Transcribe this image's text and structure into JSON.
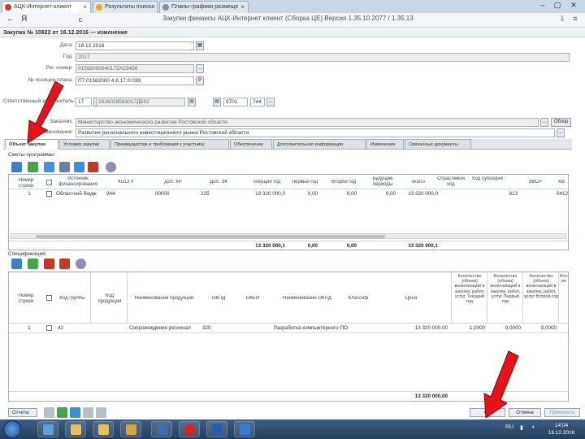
{
  "browser": {
    "tabs": [
      {
        "label": "АЦК-Интернет-клиент",
        "active": true
      },
      {
        "label": "Результаты поиска",
        "active": false
      },
      {
        "label": "Планы-графики размеще",
        "active": false
      }
    ],
    "back": "←",
    "yandex": "Я",
    "reload": "c",
    "url": "Закупки финансы АЦК-Интернет клиент (Сборка ЦЕ) Версия 1.35.10.2077 / 1.35.13"
  },
  "app": {
    "document_title": "Закупка № 10822 от 16.12.2016 — изменение",
    "fields": {
      "date_label": "Дата:",
      "date_value": "18.12.2016",
      "year_label": "Год:",
      "year_value": "2017",
      "reg_number_label": "Рег. номер:",
      "reg_number_value": "0159200004017ZA23456",
      "plan_number_label": "№ позиции плана:",
      "plan_number_value": "П7.01582000 4.8.17.0.039",
      "customer_label": "Ответственный исполнитель:",
      "customer_code": "17",
      "customer_inn": "2016028583017ДБ02",
      "customer_code2": "9701",
      "customer_code3": "744",
      "organization_label": "Заказчик:",
      "organization_value": "Министерство экономического развития Ростовской области",
      "name_label": "Наименование:",
      "name_value": "Развитие регионального инвестиционного рынка Ростовской области",
      "browse_label": "Обзор"
    },
    "tabs": [
      "Объект закупки",
      "Условия закупки",
      "Преимущества и требования к участнику",
      "Обеспечение",
      "Дополнительная информация",
      "Изменения",
      "Связанные документы"
    ],
    "finance": {
      "title": "Сметы-программы:",
      "headers": [
        "Номер строки",
        "",
        "Источник финансирования",
        "КОСГУ",
        "Доп. КР",
        "Доп. ЭК",
        "Текущий год",
        "Первый год",
        "Второй год",
        "Будущие периоды",
        "Всего",
        "Отраслевой код",
        "Код субсидии",
        "КВСР",
        "КВ"
      ],
      "row": [
        "1",
        "",
        "Областной бюдж",
        "244",
        "00000",
        "225",
        "13 320 000,0",
        "0,00",
        "0,00",
        "0,00",
        "13 320 000,0",
        "",
        "",
        "813",
        "0412"
      ],
      "totals": [
        "13 320 000,1",
        "0,00",
        "0,00",
        "13 320 000,1"
      ]
    },
    "spec": {
      "title": "Спецификация:",
      "headers": [
        "Номер строки",
        "",
        "Код группы",
        "Код продукции",
        "Наименование продукции",
        "ОКПД",
        "ОКЕИ",
        "Наименование ОКПД",
        "Классиф",
        "Цена",
        "Количество (объем) включающий в закупку, работ, услуг Текущий год",
        "Количество (объем) включающий в закупку, работ, услуг Первый год",
        "Количество (объем) включающий в закупку, работ, услуг Второй год",
        "Кол-во"
      ],
      "row": [
        "1",
        "",
        "42",
        "",
        "Сопровождение регионал",
        "320",
        "",
        "Разработка компьютерного ПО",
        "",
        "13 320 000,00",
        "1,0000",
        "0,0000",
        "0,0000"
      ],
      "total": "13 320 000,00"
    },
    "footer": {
      "ok_left": "Отчеты",
      "ok": "ОК",
      "cancel": "Отмена",
      "apply": "Применить"
    }
  },
  "taskbar": {
    "clock_time": "14:04",
    "clock_date": "18.12.2016",
    "lang": "RU"
  },
  "colors": {
    "arrow": "#e5141a",
    "accent": "#2d5c8c"
  }
}
